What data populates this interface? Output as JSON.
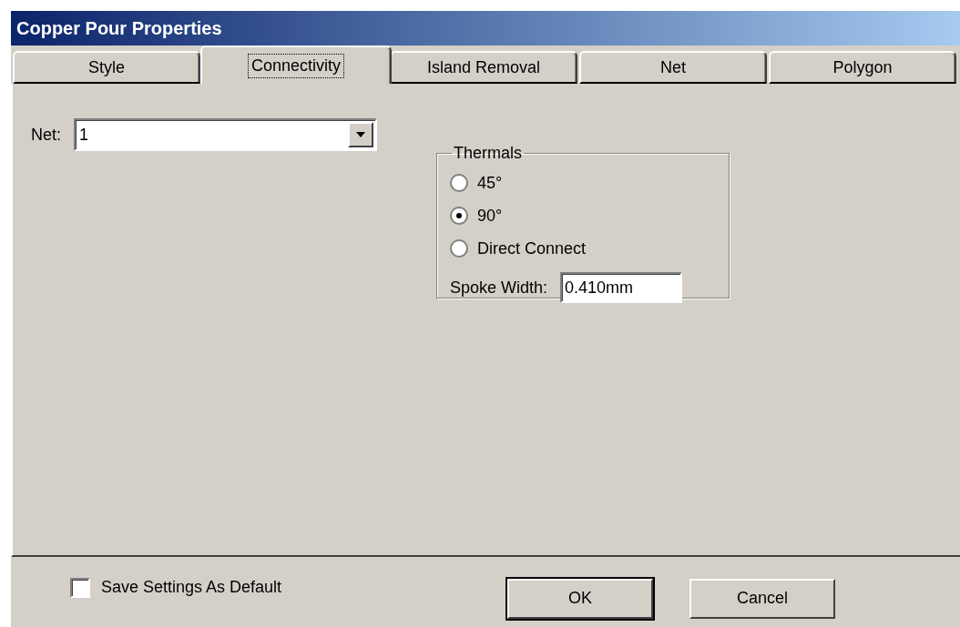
{
  "window": {
    "title": "Copper Pour Properties"
  },
  "tabs": [
    {
      "label": "Style",
      "selected": false
    },
    {
      "label": "Connectivity",
      "selected": true
    },
    {
      "label": "Island Removal",
      "selected": false
    },
    {
      "label": "Net",
      "selected": false
    },
    {
      "label": "Polygon",
      "selected": false
    }
  ],
  "net": {
    "label": "Net:",
    "value": "1"
  },
  "thermals": {
    "title": "Thermals",
    "options": [
      {
        "label": "45°",
        "selected": false
      },
      {
        "label": "90°",
        "selected": true
      },
      {
        "label": "Direct Connect",
        "selected": false
      }
    ],
    "spoke_width": {
      "label": "Spoke Width:",
      "value": "0.410mm"
    }
  },
  "save_default": {
    "label": "Save Settings As Default",
    "checked": false
  },
  "buttons": [
    {
      "label": "OK",
      "default": true
    },
    {
      "label": "Cancel",
      "default": false
    }
  ]
}
